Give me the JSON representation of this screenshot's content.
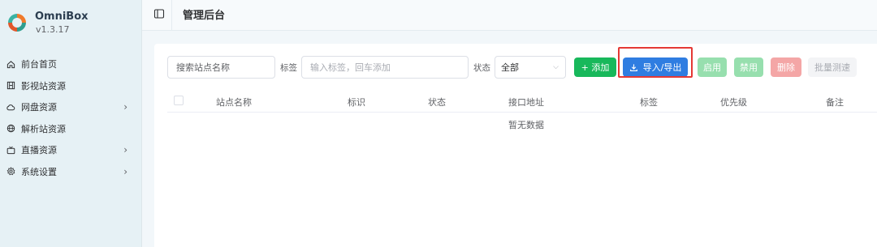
{
  "brand": {
    "name": "OmniBox",
    "version": "v1.3.17"
  },
  "sidebar": {
    "items": [
      {
        "label": "前台首页",
        "icon": "home-icon",
        "has_children": false
      },
      {
        "label": "影视站资源",
        "icon": "film-icon",
        "has_children": false
      },
      {
        "label": "网盘资源",
        "icon": "cloud-icon",
        "has_children": true
      },
      {
        "label": "解析站资源",
        "icon": "globe-icon",
        "has_children": false
      },
      {
        "label": "直播资源",
        "icon": "tv-icon",
        "has_children": true
      },
      {
        "label": "系统设置",
        "icon": "gear-icon",
        "has_children": true
      }
    ]
  },
  "header": {
    "title": "管理后台"
  },
  "toolbar": {
    "search_placeholder": "搜索站点名称",
    "tags_label": "标签",
    "tags_placeholder": "输入标签，回车添加",
    "status_label": "状态",
    "status_value": "全部",
    "add_label": "+ 添加",
    "import_export_label": "导入/导出",
    "enable_label": "启用",
    "disable_label": "禁用",
    "delete_label": "删除",
    "batch_test_label": "批量测速"
  },
  "table": {
    "columns": [
      "站点名称",
      "标识",
      "状态",
      "接口地址",
      "标签",
      "优先级",
      "备注"
    ],
    "empty_text": "暂无数据"
  },
  "colors": {
    "primary": "#2f7de1",
    "success": "#18b85b",
    "danger": "#f4a6a6",
    "highlight": "#e53935"
  }
}
